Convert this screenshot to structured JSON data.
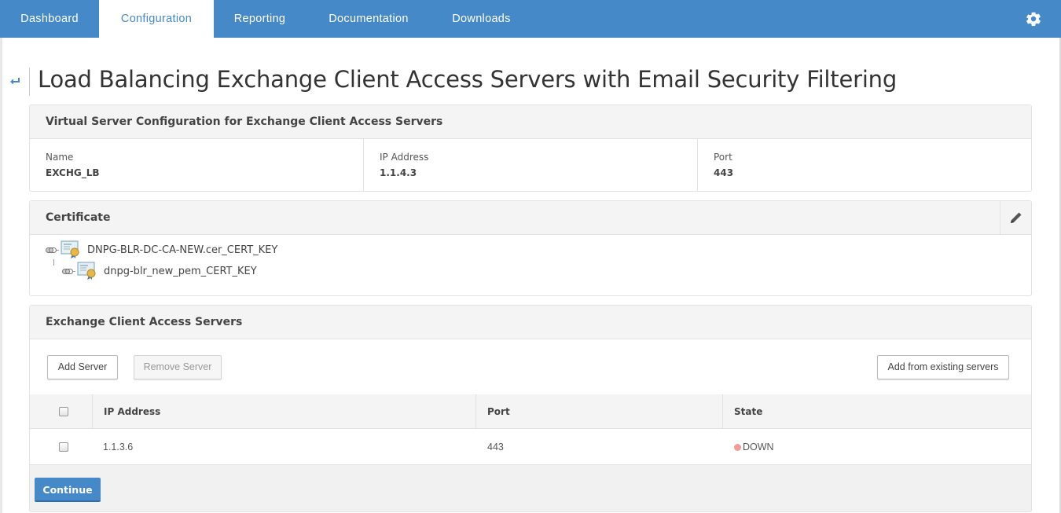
{
  "nav": {
    "tabs": [
      {
        "label": "Dashboard",
        "active": false
      },
      {
        "label": "Configuration",
        "active": true
      },
      {
        "label": "Reporting",
        "active": false
      },
      {
        "label": "Documentation",
        "active": false
      },
      {
        "label": "Downloads",
        "active": false
      }
    ],
    "settings_icon": "gear-icon"
  },
  "page": {
    "back_icon": "back-arrow-icon",
    "title": "Load Balancing Exchange Client Access Servers with Email Security Filtering"
  },
  "virtual_server": {
    "heading": "Virtual Server Configuration for Exchange Client Access Servers",
    "fields": [
      {
        "label": "Name",
        "value": "EXCHG_LB"
      },
      {
        "label": "IP Address",
        "value": "1.1.4.3"
      },
      {
        "label": "Port",
        "value": "443"
      }
    ]
  },
  "certificate": {
    "heading": "Certificate",
    "edit_icon": "pencil-icon",
    "items": [
      {
        "name": "DNPG-BLR-DC-CA-NEW.cer_CERT_KEY",
        "level": 0
      },
      {
        "name": "dnpg-blr_new_pem_CERT_KEY",
        "level": 1
      }
    ]
  },
  "servers": {
    "heading": "Exchange Client Access Servers",
    "buttons": {
      "add": "Add Server",
      "remove": "Remove Server",
      "add_existing": "Add from existing servers"
    },
    "columns": [
      "IP Address",
      "Port",
      "State"
    ],
    "rows": [
      {
        "ip": "1.1.3.6",
        "port": "443",
        "state": "DOWN",
        "state_color": "#f29b9b",
        "checked": false
      }
    ],
    "continue_label": "Continue"
  },
  "colors": {
    "brand": "#4589c9",
    "state_down": "#f29b9b"
  }
}
